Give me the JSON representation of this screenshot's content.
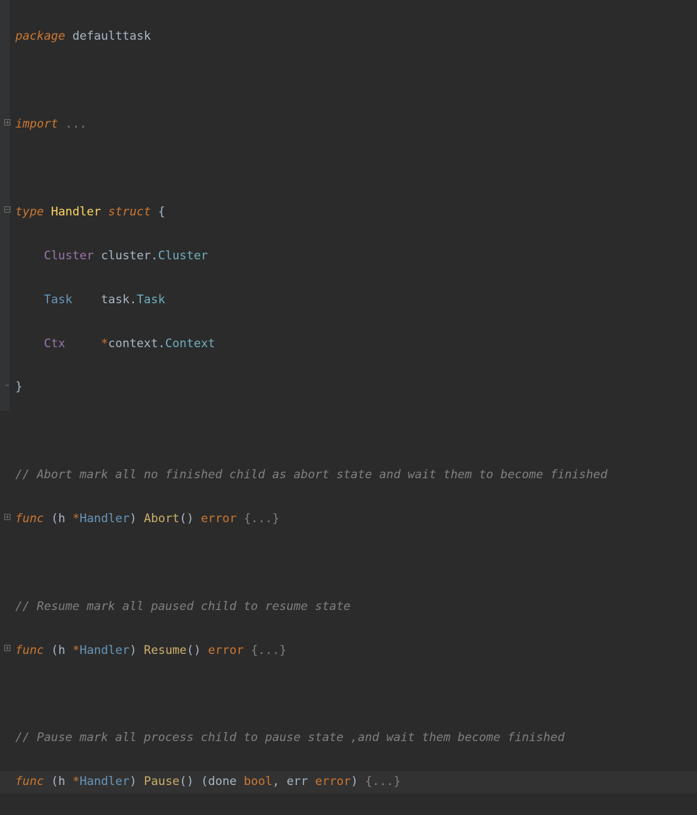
{
  "line1": {
    "kw": "package",
    "name": "defaulttask"
  },
  "line3": {
    "kw": "import",
    "ellipsis": "..."
  },
  "line5": {
    "kw_type": "type",
    "name": "Handler",
    "kw_struct": "struct",
    "brace": "{"
  },
  "line6": {
    "field": "Cluster",
    "pkg": "cluster",
    "dot": ".",
    "type": "Cluster"
  },
  "line7": {
    "field": "Task",
    "pkg": "task",
    "dot": ".",
    "type": "Task"
  },
  "line8": {
    "field": "Ctx",
    "star": "*",
    "pkg": "context",
    "dot": ".",
    "type": "Context"
  },
  "line9": {
    "brace": "}"
  },
  "comment_abort": "// Abort mark all no finished child as abort state and wait them to become finished",
  "func_abort": {
    "kw": "func",
    "recv_open": "(",
    "recv_name": "h",
    "recv_star": "*",
    "recv_type": "Handler",
    "recv_close": ")",
    "name": "Abort",
    "parens": "()",
    "ret": "error",
    "body": "{...}"
  },
  "comment_resume": "// Resume mark all paused child to resume state",
  "func_resume": {
    "kw": "func",
    "recv_open": "(",
    "recv_name": "h",
    "recv_star": "*",
    "recv_type": "Handler",
    "recv_close": ")",
    "name": "Resume",
    "parens": "()",
    "ret": "error",
    "body": "{...}"
  },
  "comment_pause": "// Pause mark all process child to pause state ,and wait them become finished",
  "func_pause": {
    "kw": "func",
    "recv_open": "(",
    "recv_name": "h",
    "recv_star": "*",
    "recv_type": "Handler",
    "recv_close": ")",
    "name": "Pause",
    "parens_open": "()",
    "ret_open": "(",
    "p1": "done",
    "p1t": "bool",
    "sep": ",",
    "p2": "err",
    "p2t": "error",
    "ret_close": ")",
    "body": "{...}"
  }
}
